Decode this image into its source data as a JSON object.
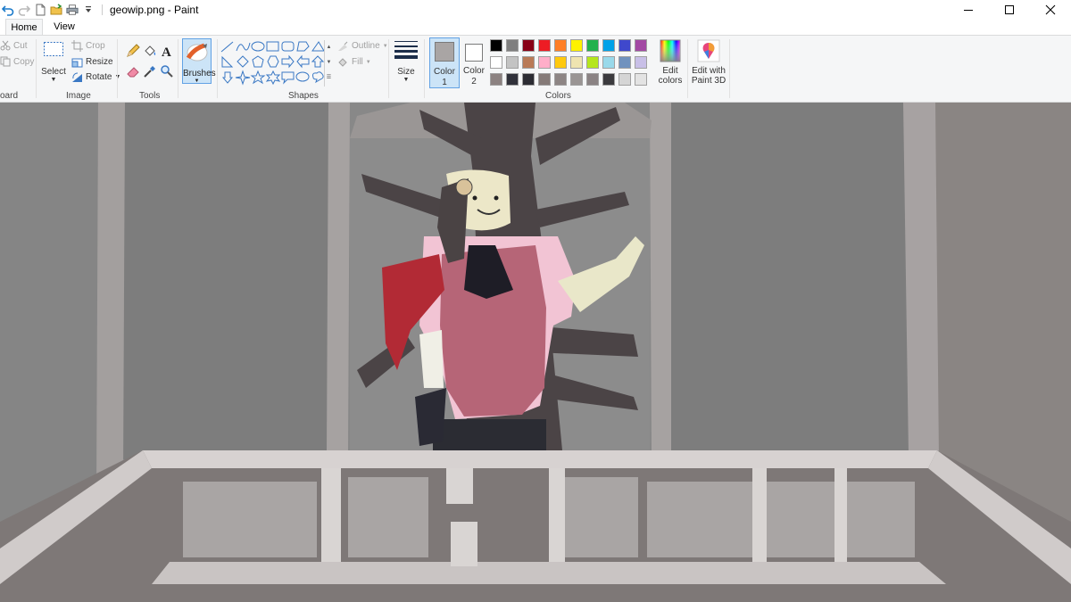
{
  "titlebar": {
    "document_title": "geowip.png - Paint",
    "quick_access": [
      "undo-icon",
      "redo-icon",
      "new-document-icon",
      "open-folder-icon",
      "print-icon",
      "customize-quick-access-icon"
    ]
  },
  "tabs": [
    {
      "label": "Home",
      "selected": true
    },
    {
      "label": "View",
      "selected": false
    }
  ],
  "ribbon": {
    "clipboard": {
      "label": "oard",
      "cut": "Cut",
      "copy": "Copy"
    },
    "image": {
      "label": "Image",
      "select": "Select",
      "crop": "Crop",
      "resize": "Resize",
      "rotate": "Rotate"
    },
    "tools": {
      "label": "Tools",
      "items": [
        "pencil-icon",
        "fill-bucket-icon",
        "text-icon",
        "eraser-icon",
        "color-picker-icon",
        "magnifier-icon"
      ]
    },
    "brushes": {
      "label": "Brushes"
    },
    "shapes": {
      "label": "Shapes",
      "outline": "Outline",
      "fill": "Fill"
    },
    "size": {
      "label": "Size"
    },
    "colors": {
      "label": "Colors",
      "color1_label": "Color",
      "color1_num": "1",
      "color2_label": "Color",
      "color2_num": "2",
      "color1_value": "#a9a5a4",
      "color2_value": "#ffffff",
      "edit_colors_line1": "Edit",
      "edit_colors_line2": "colors",
      "paint3d_line1": "Edit with",
      "paint3d_line2": "Paint 3D",
      "palette_row1": [
        "#000000",
        "#7f7f7f",
        "#880015",
        "#ed1c24",
        "#ff7f27",
        "#fff200",
        "#22b14c",
        "#00a2e8",
        "#3f48cc",
        "#a349a4"
      ],
      "palette_row2": [
        "#ffffff",
        "#c3c3c3",
        "#b97a57",
        "#ffaec9",
        "#ffc90e",
        "#efe4b0",
        "#b5e61d",
        "#99d9ea",
        "#7092be",
        "#c8bfe7"
      ],
      "palette_row3": [
        "#8c8281",
        "#30313a",
        "#2c2c33",
        "#857a78",
        "#8d8584",
        "#9a9594",
        "#8b8384",
        "#3b3a3e",
        "#d5d5d5",
        "#e3e3e3"
      ]
    }
  },
  "canvas": {
    "image_name": "geowip.png"
  }
}
